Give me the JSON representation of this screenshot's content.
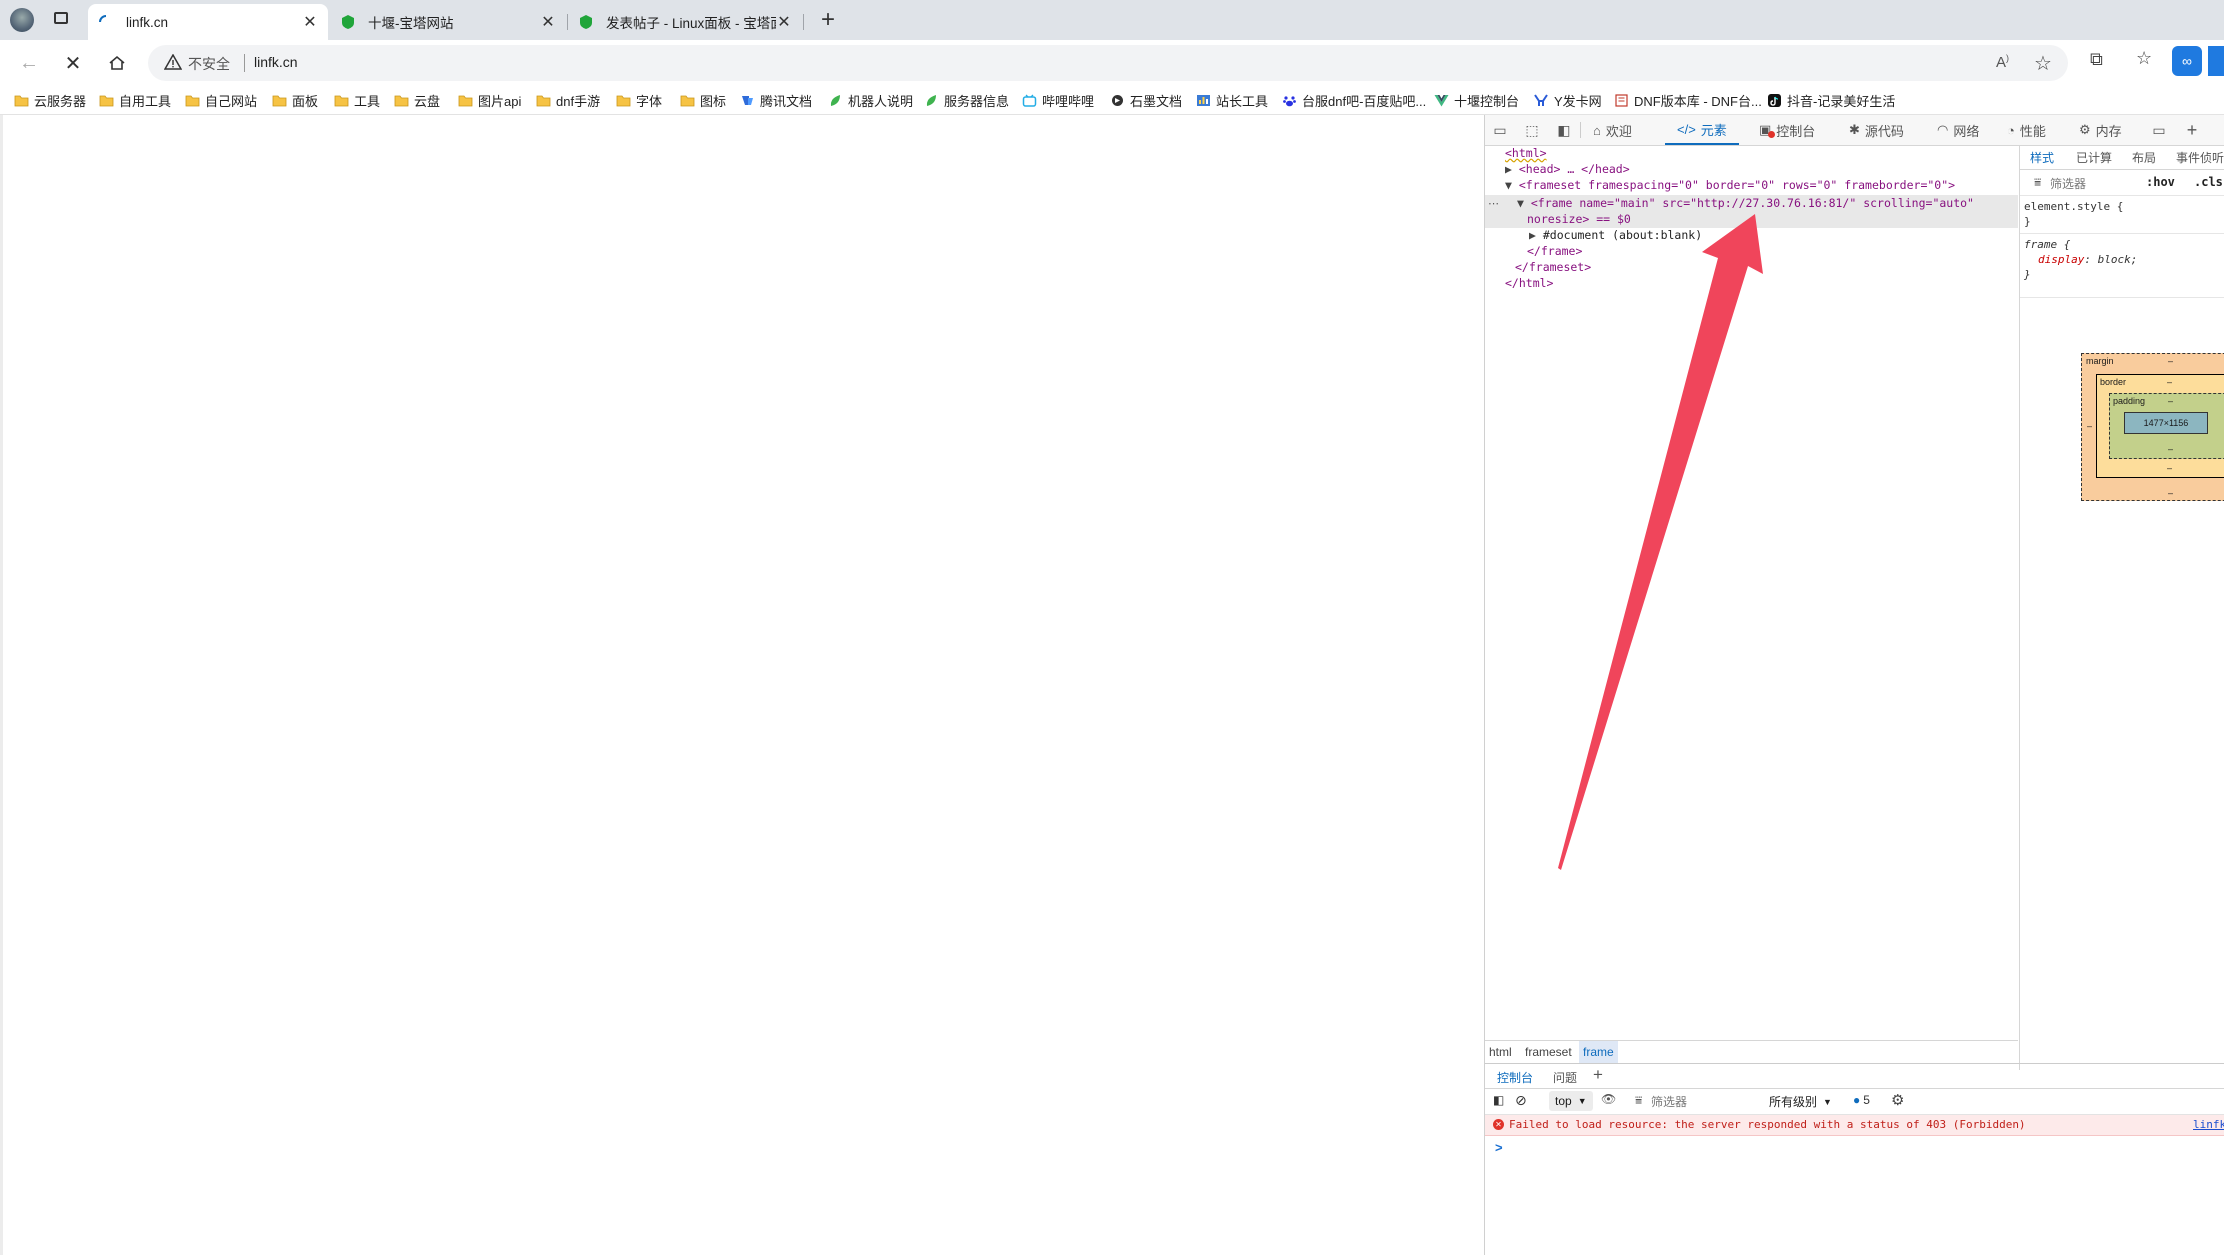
{
  "tabs": [
    {
      "title": "linfk.cn",
      "active": true,
      "loading": true
    },
    {
      "title": "十堰-宝塔网站",
      "active": false
    },
    {
      "title": "发表帖子 - Linux面板 - 宝塔面板",
      "active": false
    }
  ],
  "address": {
    "security_label": "不安全",
    "url": "linfk.cn"
  },
  "bookmarks": [
    {
      "label": "云服务器",
      "icon": "folder-icon"
    },
    {
      "label": "自用工具",
      "icon": "folder-icon"
    },
    {
      "label": "自己网站",
      "icon": "folder-icon"
    },
    {
      "label": "面板",
      "icon": "folder-icon"
    },
    {
      "label": "工具",
      "icon": "folder-icon"
    },
    {
      "label": "云盘",
      "icon": "folder-icon"
    },
    {
      "label": "图片api",
      "icon": "folder-icon"
    },
    {
      "label": "dnf手游",
      "icon": "folder-icon"
    },
    {
      "label": "字体",
      "icon": "folder-icon"
    },
    {
      "label": "图标",
      "icon": "folder-icon"
    },
    {
      "label": "腾讯文档",
      "icon": "tencent-docs-icon"
    },
    {
      "label": "机器人说明",
      "icon": "leaf-icon"
    },
    {
      "label": "服务器信息",
      "icon": "leaf-icon"
    },
    {
      "label": "哔哩哔哩",
      "icon": "bilibili-icon"
    },
    {
      "label": "石墨文档",
      "icon": "shimo-icon"
    },
    {
      "label": "站长工具",
      "icon": "chart-icon"
    },
    {
      "label": "台服dnf吧-百度贴吧...",
      "icon": "baidu-icon"
    },
    {
      "label": "十堰控制台",
      "icon": "vue-icon"
    },
    {
      "label": "Y发卡网",
      "icon": "y-icon"
    },
    {
      "label": "DNF版本库 - DNF台...",
      "icon": "book-icon"
    },
    {
      "label": "抖音-记录美好生活",
      "icon": "tiktok-icon"
    }
  ],
  "devtools": {
    "tabs": [
      "欢迎",
      "元素",
      "控制台",
      "源代码",
      "网络",
      "性能",
      "内存"
    ],
    "elements": {
      "lines": [
        "<html>",
        "<head> … </head>",
        "<frameset framespacing=\"0\" border=\"0\" rows=\"0\" frameborder=\"0\">",
        "<frame name=\"main\" src=\"http://27.30.76.16:81/\" scrolling=\"auto\"",
        "noresize> == $0",
        "#document (about:blank)",
        "</frame>",
        "</frameset>",
        "</html>"
      ],
      "document_link": "about:blank"
    },
    "styles": {
      "tabs": [
        "样式",
        "已计算",
        "布局",
        "事件侦听"
      ],
      "filter_placeholder": "筛选器",
      "hov": ":hov",
      "cls": ".cls",
      "element_style": "element.style {",
      "close_brace": "}",
      "rule_selector": "frame {",
      "rule_prop": "display",
      "rule_value": "block;",
      "box_model": {
        "margin_label": "margin",
        "border_label": "border",
        "padding_label": "padding",
        "dash": "–",
        "content_size": "1477×1156"
      }
    },
    "breadcrumbs": [
      "html",
      "frameset",
      "frame"
    ],
    "console": {
      "tabs": [
        "控制台",
        "问题"
      ],
      "context": "top",
      "filter_placeholder": "筛选器",
      "levels": "所有级别",
      "message_count": "5",
      "error_message": "Failed to load resource: the server responded with a status of 403 (Forbidden)",
      "error_source": "linfk",
      "prompt": ">"
    }
  },
  "colors": {
    "arrow": "#f0455b",
    "error_bg": "#fdeaea",
    "error_icon": "#e0332a",
    "accent": "#0f6cbd"
  }
}
